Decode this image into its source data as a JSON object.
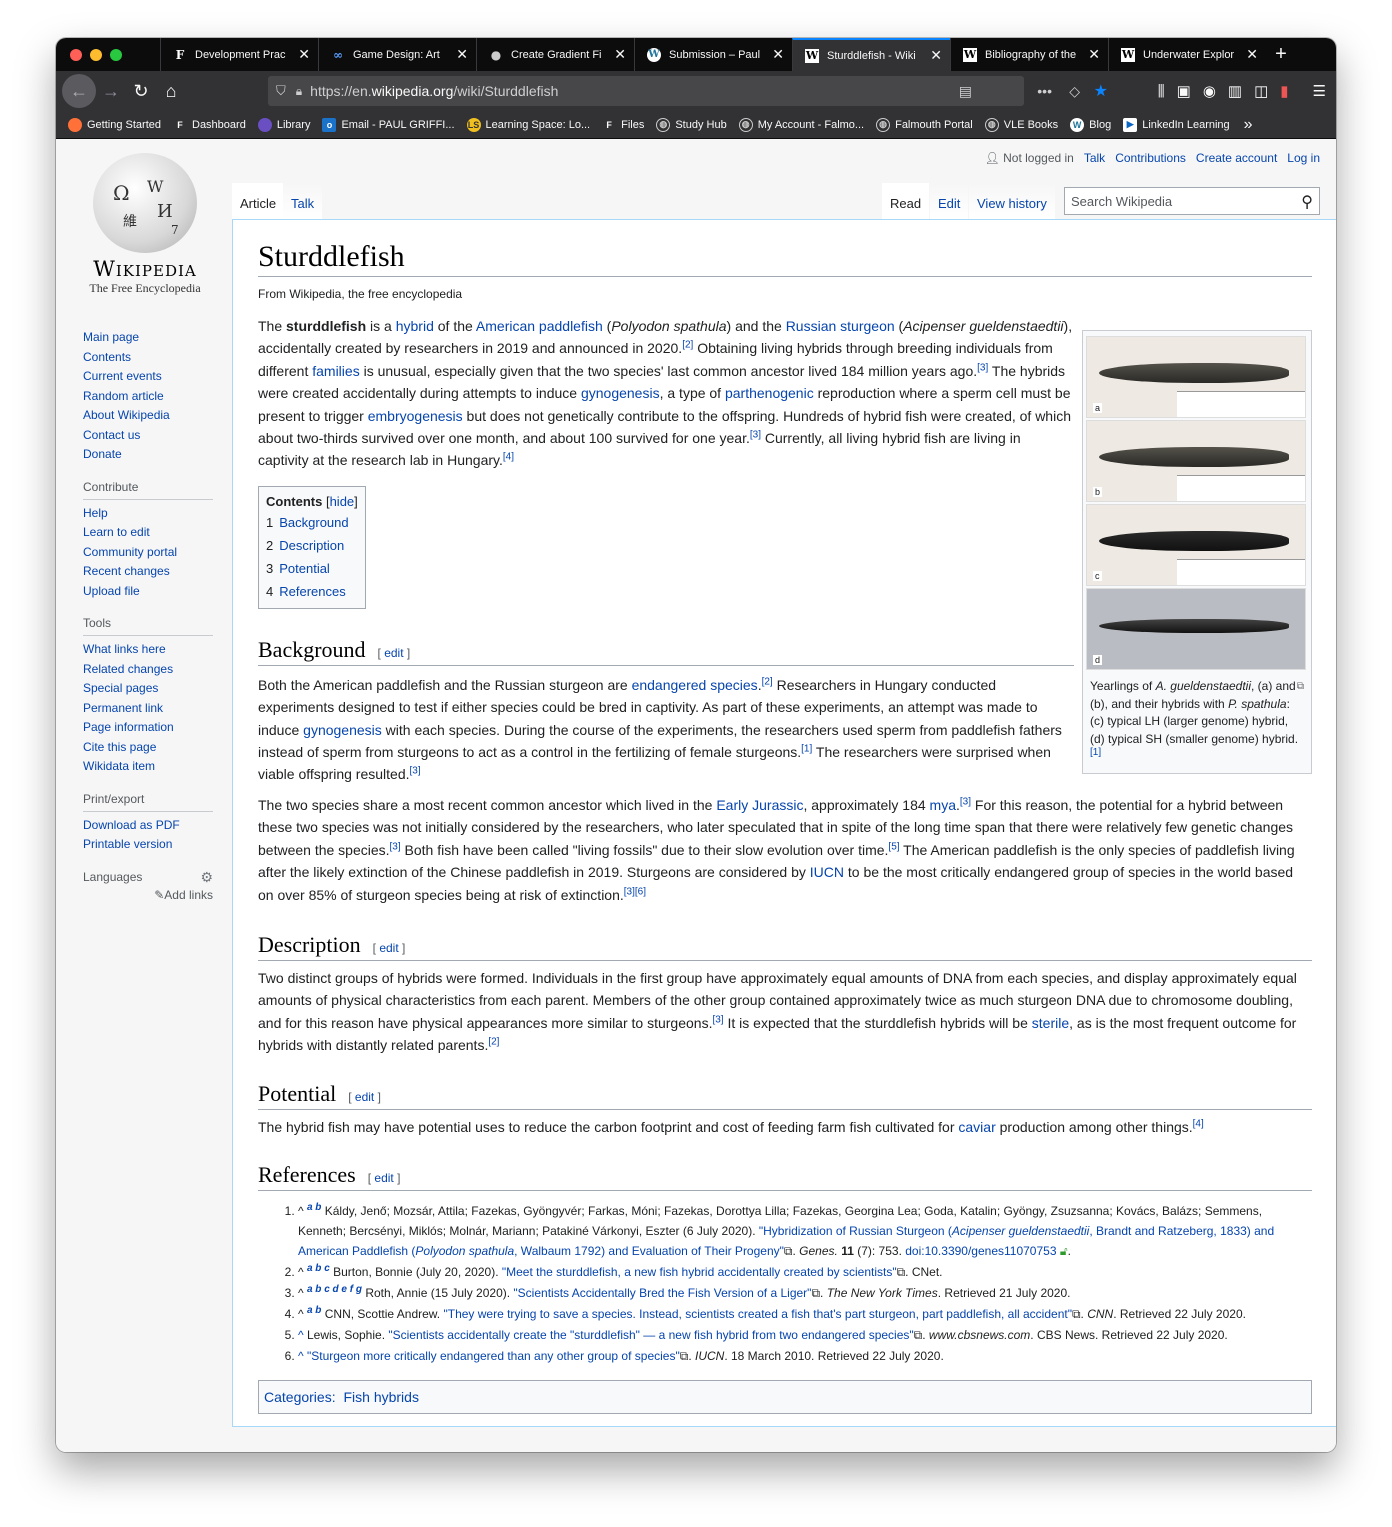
{
  "browser": {
    "tabs": [
      {
        "title": "Development Prac",
        "icon": "F"
      },
      {
        "title": "Game Design: Art",
        "icon": "co"
      },
      {
        "title": "Create Gradient Fi",
        "icon": "apple"
      },
      {
        "title": "Submission – Paul",
        "icon": "W"
      },
      {
        "title": "Sturddlefish - Wiki",
        "icon": "W",
        "active": true
      },
      {
        "title": "Bibliography of the",
        "icon": "W"
      },
      {
        "title": "Underwater Explor",
        "icon": "W"
      }
    ],
    "url_prefix": "https://en.",
    "url_host": "wikipedia.org",
    "url_path": "/wiki/Sturddlefish",
    "bookmarks": [
      "Getting Started",
      "Dashboard",
      "Library",
      "Email - PAUL GRIFFI...",
      "Learning Space: Lo...",
      "Files",
      "Study Hub",
      "My Account - Falmo...",
      "Falmouth Portal",
      "VLE Books",
      "Blog",
      "LinkedIn Learning"
    ]
  },
  "wiki": {
    "wordmark": "Wikipedia",
    "tagline": "The Free Encyclopedia",
    "personal": {
      "not_logged": "Not logged in",
      "talk": "Talk",
      "contributions": "Contributions",
      "create": "Create account",
      "login": "Log in"
    },
    "tabs": {
      "article": "Article",
      "talk": "Talk",
      "read": "Read",
      "edit": "Edit",
      "history": "View history"
    },
    "search_placeholder": "Search Wikipedia",
    "nav": [
      "Main page",
      "Contents",
      "Current events",
      "Random article",
      "About Wikipedia",
      "Contact us",
      "Donate"
    ],
    "contribute_heading": "Contribute",
    "contribute": [
      "Help",
      "Learn to edit",
      "Community portal",
      "Recent changes",
      "Upload file"
    ],
    "tools_heading": "Tools",
    "tools": [
      "What links here",
      "Related changes",
      "Special pages",
      "Permanent link",
      "Page information",
      "Cite this page",
      "Wikidata item"
    ],
    "print_heading": "Print/export",
    "print": [
      "Download as PDF",
      "Printable version"
    ],
    "languages_heading": "Languages",
    "add_links": "Add links"
  },
  "article": {
    "title": "Sturddlefish",
    "from": "From Wikipedia, the free encyclopedia",
    "toc_title": "Contents",
    "toc_hide": "hide",
    "toc": [
      {
        "num": "1",
        "label": "Background"
      },
      {
        "num": "2",
        "label": "Description"
      },
      {
        "num": "3",
        "label": "Potential"
      },
      {
        "num": "4",
        "label": "References"
      }
    ],
    "edit": "edit",
    "sections": {
      "background": "Background",
      "description": "Description",
      "potential": "Potential",
      "references": "References"
    },
    "photo_labels": [
      "a",
      "b",
      "c",
      "d"
    ],
    "caption": "Yearlings of A. gueldenstaedtii, (a) and (b), and their hybrids with P. spathula: (c) typical LH (larger genome) hybrid, (d) typical SH (smaller genome) hybrid.[1]",
    "categories_label": "Categories:",
    "category": "Fish hybrids"
  }
}
